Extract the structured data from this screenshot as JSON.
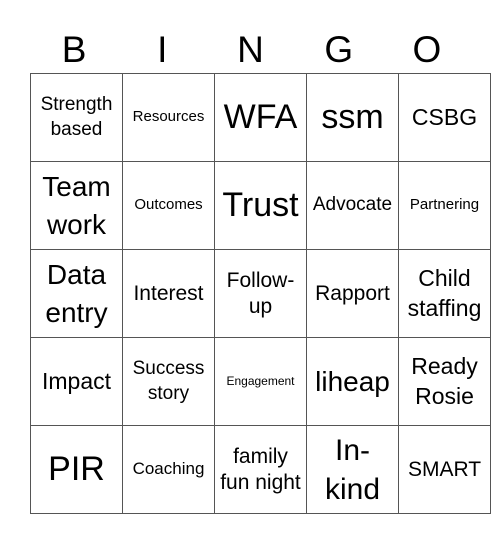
{
  "header": [
    "B",
    "I",
    "N",
    "G",
    "O"
  ],
  "cells": [
    [
      "Strength based",
      "Resources",
      "WFA",
      "ssm",
      "CSBG"
    ],
    [
      "Team work",
      "Outcomes",
      "Trust",
      "Advocate",
      "Partnering"
    ],
    [
      "Data entry",
      "Interest",
      "Follow-up",
      "Rapport",
      "Child staffing"
    ],
    [
      "Impact",
      "Success story",
      "Engagement",
      "liheap",
      "Ready Rosie"
    ],
    [
      "PIR",
      "Coaching",
      "family fun night",
      "In-kind",
      "SMART"
    ]
  ]
}
